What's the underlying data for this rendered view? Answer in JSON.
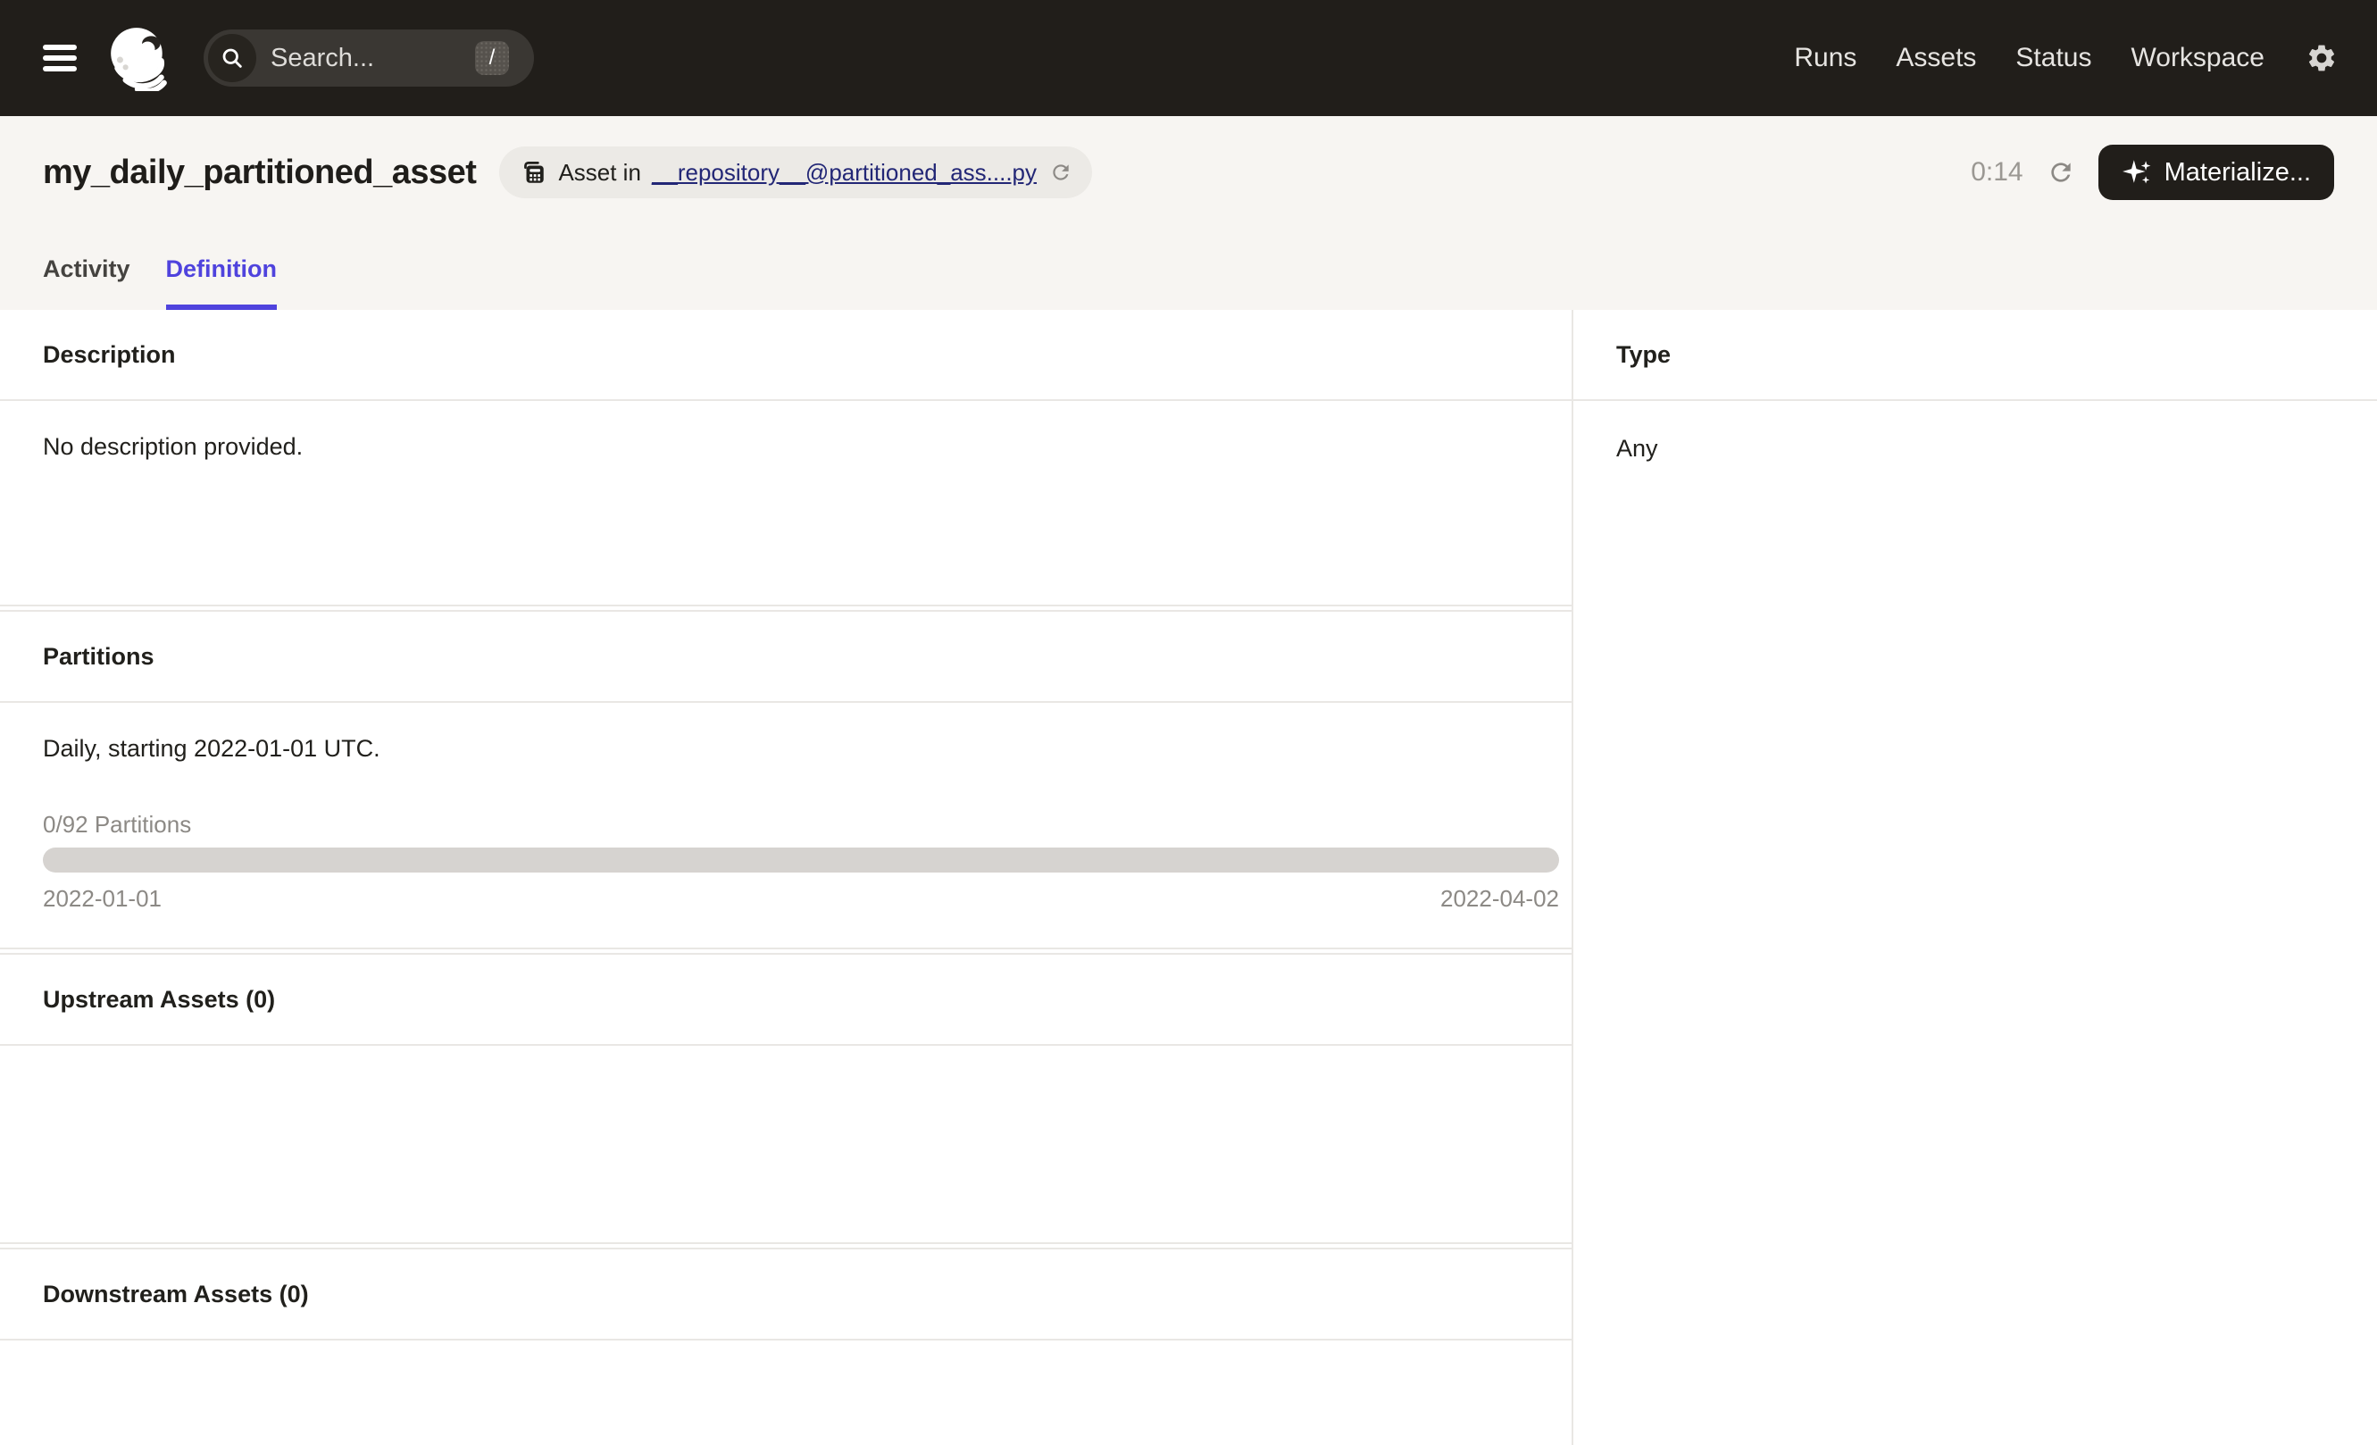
{
  "navbar": {
    "search": {
      "placeholder": "Search...",
      "shortcut_key": "/"
    },
    "links": [
      {
        "label": "Runs"
      },
      {
        "label": "Assets"
      },
      {
        "label": "Status"
      },
      {
        "label": "Workspace"
      }
    ],
    "icons": {
      "menu": "hamburger-menu-icon",
      "logo": "dagster-logo",
      "search": "search-icon",
      "settings": "gear-icon"
    }
  },
  "page_header": {
    "title": "my_daily_partitioned_asset",
    "badge": {
      "icon": "asset-group-icon",
      "prefix": "Asset in",
      "link": "__repository__@partitioned_ass....py",
      "reload_icon": "reload-icon"
    },
    "timer": "0:14",
    "refresh_icon": "refresh-icon",
    "materialize": {
      "label": "Materialize...",
      "icon": "sparkle-icon"
    }
  },
  "tabs": [
    {
      "label": "Activity",
      "active": false
    },
    {
      "label": "Definition",
      "active": true
    }
  ],
  "sections": {
    "description": {
      "header": "Description",
      "body": "No description provided."
    },
    "type": {
      "header": "Type",
      "body": "Any"
    },
    "partitions": {
      "header": "Partitions",
      "summary": "Daily, starting 2022-01-01 UTC.",
      "progress_label": "0/92 Partitions",
      "progress_fraction": 0,
      "range_start": "2022-01-01",
      "range_end": "2022-04-02"
    },
    "upstream": {
      "header": "Upstream Assets (0)"
    },
    "downstream": {
      "header": "Downstream Assets (0)"
    }
  },
  "colors": {
    "navbar_bg": "#211e1a",
    "header_bg": "#f7f5f2",
    "accent": "#4f43dd",
    "link_navy": "#232776",
    "border": "#e9e7e4",
    "muted_text": "#8c8985",
    "progress_track": "#d6d3d0"
  }
}
